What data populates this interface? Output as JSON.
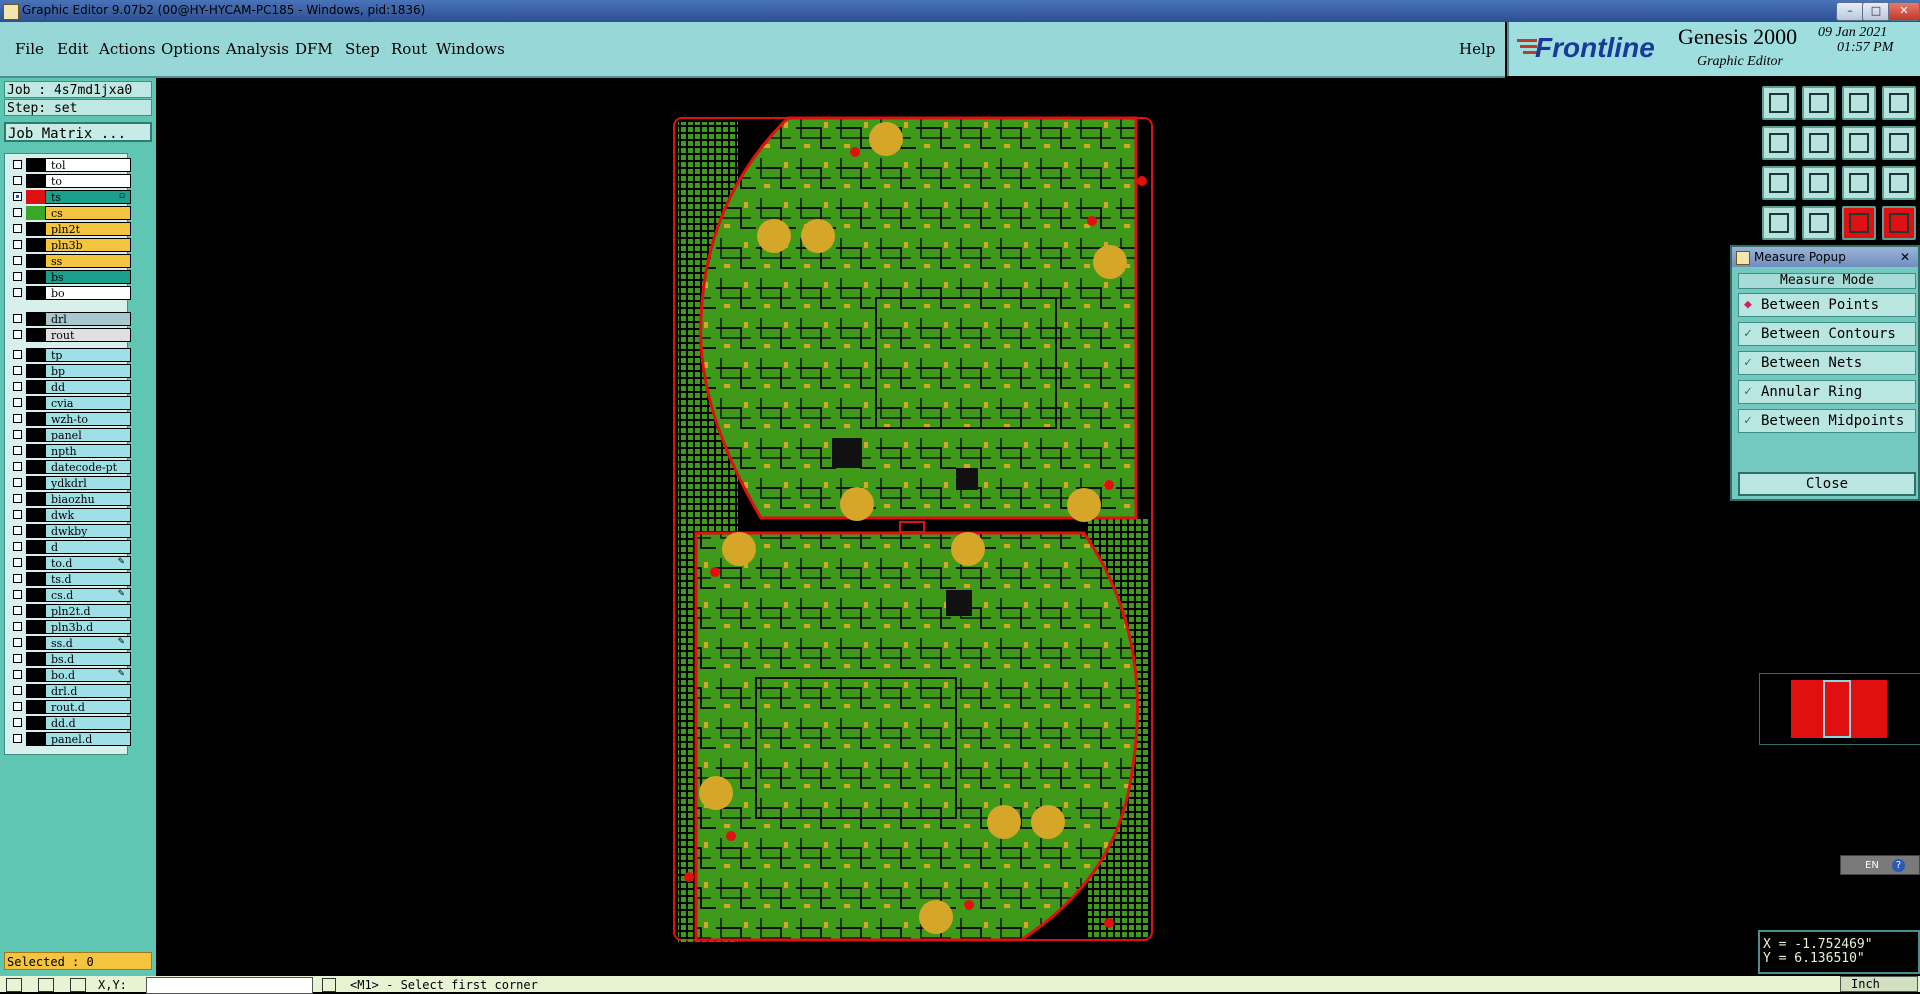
{
  "window": {
    "title": "Graphic Editor 9.07b2 (00@HY-HYCAM-PC185 - Windows, pid:1836)"
  },
  "menu": {
    "items": [
      "File",
      "Edit",
      "Actions",
      "Options",
      "Analysis",
      "DFM",
      "Step",
      "Rout",
      "Windows"
    ],
    "help": "Help"
  },
  "brand": {
    "logo": "Frontline",
    "product": "Genesis 2000",
    "subtitle": "Graphic Editor",
    "date": "09 Jan 2021",
    "time": "01:57 PM"
  },
  "job": {
    "job_line": "Job : 4s7md1jxa0",
    "step_line": "Step: set",
    "matrix_button": "Job Matrix ..."
  },
  "layers": [
    {
      "name": "tol",
      "color": "#000000",
      "fill": "#ffffff",
      "checked": false
    },
    {
      "name": "to",
      "color": "#000000",
      "fill": "#ffffff",
      "checked": false
    },
    {
      "name": "ts",
      "color": "#e01010",
      "fill": "#1aa08a",
      "checked": true,
      "mark": "▫"
    },
    {
      "name": "cs",
      "color": "#3aa62a",
      "fill": "#f4c43e",
      "checked": false
    },
    {
      "name": "pln2t",
      "color": "#000000",
      "fill": "#f4c43e",
      "checked": false
    },
    {
      "name": "pln3b",
      "color": "#000000",
      "fill": "#f4c43e",
      "checked": false
    },
    {
      "name": "ss",
      "color": "#000000",
      "fill": "#f4c43e",
      "checked": false
    },
    {
      "name": "bs",
      "color": "#000000",
      "fill": "#1aa08a",
      "checked": false
    },
    {
      "name": "bo",
      "color": "#000000",
      "fill": "#ffffff",
      "checked": false
    },
    {
      "name": "drl",
      "color": "#000000",
      "fill": "#a8c8d0",
      "checked": false
    },
    {
      "name": "rout",
      "color": "#000000",
      "fill": "#e0e0e0",
      "checked": false
    },
    {
      "name": "tp",
      "color": "#000000",
      "fill": "#9fe0e6",
      "checked": false
    },
    {
      "name": "bp",
      "color": "#000000",
      "fill": "#9fe0e6",
      "checked": false
    },
    {
      "name": "dd",
      "color": "#000000",
      "fill": "#9fe0e6",
      "checked": false
    },
    {
      "name": "cvia",
      "color": "#000000",
      "fill": "#9fe0e6",
      "checked": false
    },
    {
      "name": "wzh-to",
      "color": "#000000",
      "fill": "#9fe0e6",
      "checked": false
    },
    {
      "name": "panel",
      "color": "#000000",
      "fill": "#9fe0e6",
      "checked": false
    },
    {
      "name": "npth",
      "color": "#000000",
      "fill": "#9fe0e6",
      "checked": false
    },
    {
      "name": "datecode-pt",
      "color": "#000000",
      "fill": "#9fe0e6",
      "checked": false
    },
    {
      "name": "ydkdrl",
      "color": "#000000",
      "fill": "#9fe0e6",
      "checked": false
    },
    {
      "name": "biaozhu",
      "color": "#000000",
      "fill": "#9fe0e6",
      "checked": false
    },
    {
      "name": "dwk",
      "color": "#000000",
      "fill": "#9fe0e6",
      "checked": false
    },
    {
      "name": "dwkby",
      "color": "#000000",
      "fill": "#9fe0e6",
      "checked": false
    },
    {
      "name": "d",
      "color": "#000000",
      "fill": "#9fe0e6",
      "checked": false
    },
    {
      "name": "to.d",
      "color": "#000000",
      "fill": "#9fe0e6",
      "checked": false,
      "mark": "✎"
    },
    {
      "name": "ts.d",
      "color": "#000000",
      "fill": "#9fe0e6",
      "checked": false
    },
    {
      "name": "cs.d",
      "color": "#000000",
      "fill": "#9fe0e6",
      "checked": false,
      "mark": "✎"
    },
    {
      "name": "pln2t.d",
      "color": "#000000",
      "fill": "#9fe0e6",
      "checked": false
    },
    {
      "name": "pln3b.d",
      "color": "#000000",
      "fill": "#9fe0e6",
      "checked": false
    },
    {
      "name": "ss.d",
      "color": "#000000",
      "fill": "#9fe0e6",
      "checked": false,
      "mark": "✎"
    },
    {
      "name": "bs.d",
      "color": "#000000",
      "fill": "#9fe0e6",
      "checked": false
    },
    {
      "name": "bo.d",
      "color": "#000000",
      "fill": "#9fe0e6",
      "checked": false,
      "mark": "✎"
    },
    {
      "name": "drl.d",
      "color": "#000000",
      "fill": "#9fe0e6",
      "checked": false
    },
    {
      "name": "rout.d",
      "color": "#000000",
      "fill": "#9fe0e6",
      "checked": false
    },
    {
      "name": "dd.d",
      "color": "#000000",
      "fill": "#9fe0e6",
      "checked": false
    },
    {
      "name": "panel.d",
      "color": "#000000",
      "fill": "#9fe0e6",
      "checked": false
    }
  ],
  "selected": "Selected : 0",
  "measure": {
    "title": "Measure Popup",
    "heading": "Measure Mode",
    "options": [
      "Between Points",
      "Between Contours",
      "Between Nets",
      "Annular Ring",
      "Between Midpoints"
    ],
    "selected_index": 0,
    "close": "Close"
  },
  "coords": {
    "x": "X = -1.752469\"",
    "y": "Y =  6.136510\""
  },
  "status": {
    "prompt": "<M1> - Select first corner",
    "xy_label": "X,Y:",
    "units": "Inch"
  },
  "ime": {
    "label": "EN"
  },
  "toolbar_icons": [
    "save-icon",
    "open-icon",
    "home-icon",
    "layout-icon",
    "step-in-icon",
    "step-out-icon",
    "redo-icon",
    "snap-icon",
    "fit-icon",
    "zoom-icon",
    "ratio-icon",
    "help-icon",
    "measure-icon",
    "cursor-icon",
    "film-icon",
    "film2-icon"
  ],
  "colors": {
    "board_green": "#3f9a1a",
    "pad_gold": "#d6a628",
    "outline_red": "#e01010",
    "panel_teal": "#60c6b4"
  }
}
